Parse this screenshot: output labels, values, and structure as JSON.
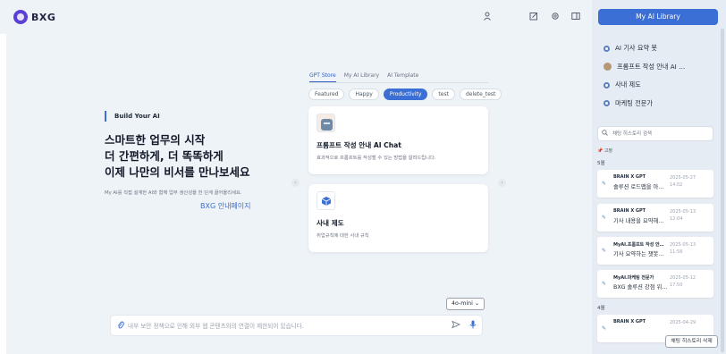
{
  "app": {
    "logo_text": "BXG"
  },
  "topbar": {
    "icons": [
      "user-icon",
      "edit-icon",
      "settings-icon",
      "sidebar-toggle-icon"
    ]
  },
  "hero": {
    "build_label": "Build Your AI",
    "headline_lines": [
      "스마트한 업무의 시작",
      "더 간편하게, 더 똑똑하게",
      "이제 나만의 비서를 만나보세요"
    ],
    "subtext": "My AI를 직접 설계한 AI와 함께 업무 생산성을 한 단계 끌어올리세요.",
    "guide_link": "BXG 안내페이지"
  },
  "store": {
    "tabs": [
      "GPT Store",
      "My AI Library",
      "AI Template"
    ],
    "active_tab": "GPT Store",
    "chips": [
      "Featured",
      "Happy",
      "Productivity",
      "test",
      "delete_test"
    ],
    "active_chip": "Productivity",
    "cards": [
      {
        "title": "프롬프트 작성 안내 AI Chat",
        "desc": "효과적으로 프롬프트를 작성할 수 있는 방법을 알려드립니다.",
        "icon": "robot-image"
      },
      {
        "title": "사내 제도",
        "desc": "취업규칙에 대한 사내 규칙",
        "icon": "cube-icon"
      }
    ]
  },
  "composer": {
    "model": "4o-mini",
    "placeholder": "내부 보안 정책으로 인해 외부 웹 콘텐츠와의 연결이 제한되어 있습니다."
  },
  "sidebar": {
    "library_button": "My AI Library",
    "gpts": [
      {
        "label": "AI 기사 요약 봇",
        "icon": "gpt-dot-icon"
      },
      {
        "label": "프롬프트 작성 안내 AI …",
        "icon": "avatar-icon"
      },
      {
        "label": "사내 제도",
        "icon": "gpt-dot-icon"
      },
      {
        "label": "마케팅 전문가",
        "icon": "gpt-dot-icon"
      }
    ],
    "search_placeholder": "채팅 히스토리 검색",
    "pinned_label": "📌 고정",
    "months": [
      "5월",
      "4월"
    ],
    "history": [
      {
        "title": "BRAIN X GPT",
        "subtitle": "솔루션 로드맵을 아…",
        "date": "2025-05-27",
        "time": "14:02"
      },
      {
        "title": "BRAIN X GPT",
        "subtitle": "기사 내용을 요약해…",
        "date": "2025-05-13",
        "time": "12:04"
      },
      {
        "title": "MyAI.프롬프트 작성 안…",
        "subtitle": "기사 요약하는 챗봇…",
        "date": "2025-05-13",
        "time": "11:56"
      },
      {
        "title": "MyAI.마케팅 전문가",
        "subtitle": "BXG 솔루션 강점 위…",
        "date": "2025-05-12",
        "time": "17:50"
      },
      {
        "title": "BRAIN X GPT",
        "subtitle": "",
        "date": "2025-04-29",
        "time": ""
      }
    ],
    "delete_button": "채팅 히스토리 삭제"
  }
}
